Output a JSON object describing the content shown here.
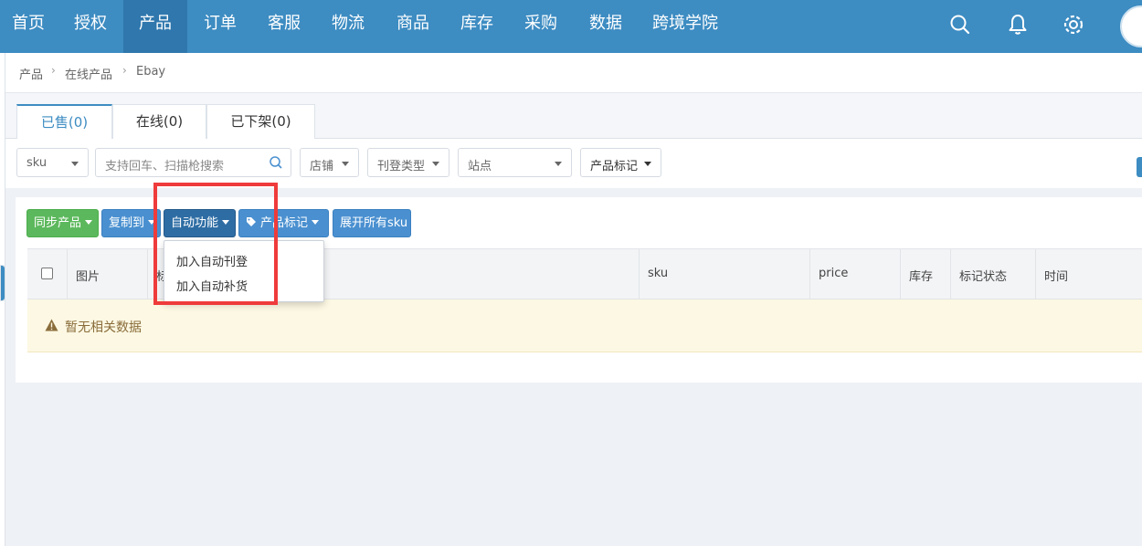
{
  "nav": {
    "items": [
      "首页",
      "授权",
      "产品",
      "订单",
      "客服",
      "物流",
      "商品",
      "库存",
      "采购",
      "数据",
      "跨境学院"
    ],
    "active_index": 2,
    "icons": [
      "search-icon",
      "bell-icon",
      "gear-icon"
    ]
  },
  "breadcrumb": [
    "产品",
    "在线产品",
    "Ebay"
  ],
  "tabs": [
    "已售(0)",
    "在线(0)",
    "已下架(0)"
  ],
  "filters": {
    "sku": "sku",
    "search_placeholder": "支持回车、扫描枪搜索",
    "store": "店铺",
    "listing_type": "刊登类型",
    "site": "站点",
    "product_tag": "产品标记"
  },
  "toolbar": {
    "sync": "同步产品",
    "copy_to": "复制到",
    "auto": "自动功能",
    "tag": "产品标记",
    "expand": "展开所有sku"
  },
  "dropdown": [
    "加入自动刊登",
    "加入自动补货"
  ],
  "table": {
    "headers": [
      "图片",
      "标",
      "sku",
      "price",
      "库存",
      "标记状态",
      "时间"
    ],
    "empty": "暂无相关数据"
  },
  "colors": {
    "nav": "#3d8cc2",
    "highlight": "#ef3b3b",
    "green": "#5cb85c",
    "blue": "#4a90d0"
  }
}
